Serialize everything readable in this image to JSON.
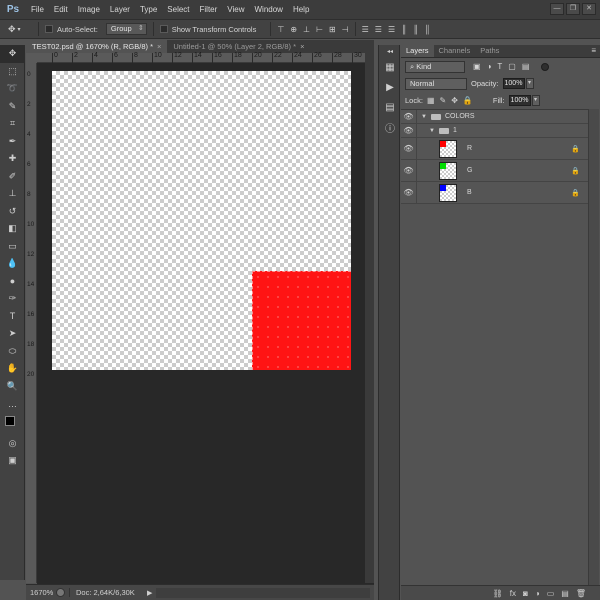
{
  "app": {
    "logo": "Ps"
  },
  "menu": [
    "File",
    "Edit",
    "Image",
    "Layer",
    "Type",
    "Select",
    "Filter",
    "View",
    "Window",
    "Help"
  ],
  "window_controls": [
    "—",
    "❐",
    "✕"
  ],
  "options_bar": {
    "auto_select_label": "Auto-Select:",
    "auto_select_value": "Group",
    "transform_label": "Show Transform Controls"
  },
  "tabs": [
    {
      "label": "TEST02.psd @ 1670% (R, RGB/8) *",
      "close": "×"
    },
    {
      "label": "Untitled-1 @ 50% (Layer 2, RGB/8) *",
      "close": "×"
    }
  ],
  "ruler": {
    "top_labels": [
      "0",
      "2",
      "4",
      "6",
      "8",
      "10",
      "12",
      "14",
      "16",
      "18",
      "20",
      "22",
      "24",
      "26",
      "28",
      "30"
    ],
    "left_labels": [
      "0",
      "2",
      "4",
      "6",
      "8",
      "10",
      "12",
      "14",
      "16",
      "18",
      "20"
    ]
  },
  "status": {
    "zoom": "1670%",
    "doc": "Doc: 2,64K/6,30K",
    "arrow": "▶"
  },
  "panel": {
    "tabs": [
      "Layers",
      "Channels",
      "Paths"
    ],
    "menu": "≡",
    "filter_kind": "Kind",
    "blend_mode": "Normal",
    "opacity_label": "Opacity:",
    "opacity_value": "100%",
    "lock_label": "Lock:",
    "fill_label": "Fill:",
    "fill_value": "100%",
    "layers": [
      {
        "name": "COLORS",
        "type": "group"
      },
      {
        "name": "1",
        "type": "group"
      },
      {
        "name": "R",
        "type": "layer",
        "color": "#ff0000"
      },
      {
        "name": "G",
        "type": "layer",
        "color": "#00dd00"
      },
      {
        "name": "B",
        "type": "layer",
        "color": "#0000ff"
      }
    ],
    "footer_icons": [
      "link-icon",
      "fx-icon",
      "mask-icon",
      "adjustment-icon",
      "folder-icon",
      "new-layer-icon",
      "trash-icon"
    ]
  },
  "colors": {
    "red_fill": "#ff1414",
    "canvas_bg": "#282828"
  }
}
